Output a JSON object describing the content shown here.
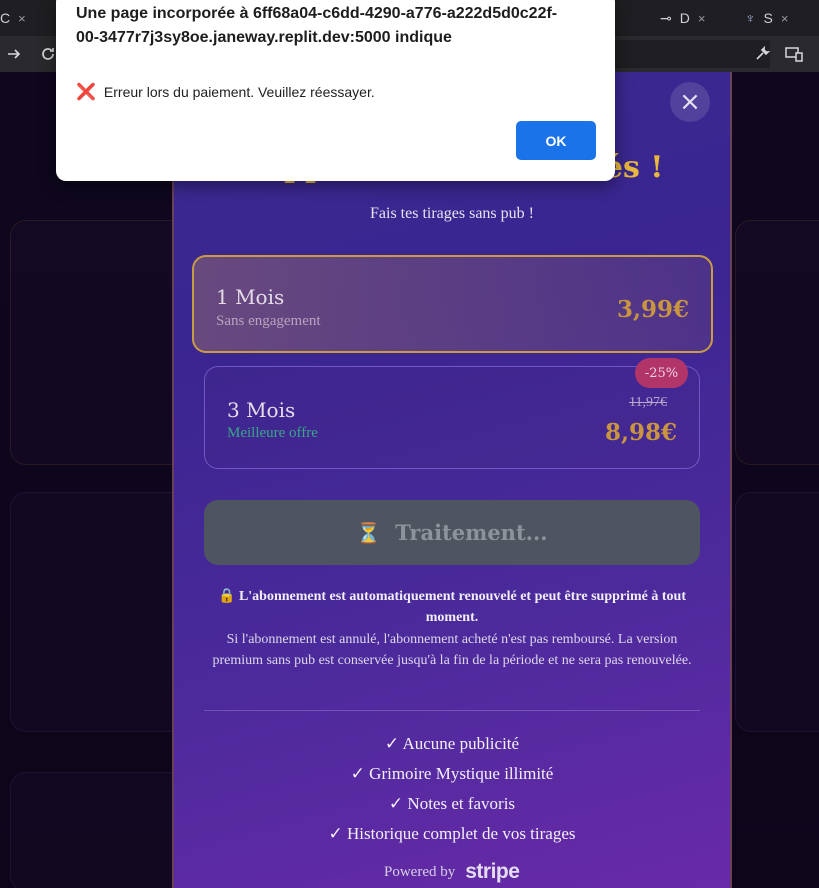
{
  "browser": {
    "tabs": [
      {
        "label": "C",
        "close": "×"
      },
      {
        "label": "D",
        "close": "×"
      },
      {
        "label": "S",
        "close": "×"
      }
    ],
    "toolbar": {
      "forward_icon": "arrow-right-icon",
      "reload_icon": "reload-icon",
      "extensions_icon": "wrench-icon",
      "devices_icon": "devices-icon"
    }
  },
  "modal": {
    "title": "Supprime les Publicités !",
    "subtitle": "Fais tes tirages sans pub !",
    "close_label": "×",
    "plans": [
      {
        "name": "1 Mois",
        "description": "Sans engagement",
        "price": "3,99€",
        "selected": true
      },
      {
        "name": "3 Mois",
        "description": "Meilleure offre",
        "old_price": "11,97€",
        "price": "8,98€",
        "badge": "-25%",
        "selected": false
      }
    ],
    "process_button": {
      "icon": "⏳",
      "label": "Traitement..."
    },
    "renewal_note": "L'abonnement est automatiquement renouvelé et peut être supprimé à tout moment.",
    "renewal_icon": "🔒",
    "cancel_note": "Si l'abonnement est annulé, l'abonnement acheté n'est pas remboursé. La version premium sans pub est conservée jusqu'à la fin de la période et ne sera pas renouvelée.",
    "features": [
      "✓ Aucune publicité",
      "✓ Grimoire Mystique illimité",
      "✓ Notes et favoris",
      "✓ Historique complet de vos tirages"
    ],
    "powered_by": "Powered by",
    "stripe": "stripe"
  },
  "alert": {
    "title": "Une page incorporée à 6ff68a04-c6dd-4290-a776-a222d5d0c22f-00-3477r7j3sy8oe.janeway.replit.dev:5000 indique",
    "icon": "❌",
    "message": "Erreur lors du paiement. Veuillez réessayer.",
    "ok_label": "OK"
  },
  "colors": {
    "accent_gold": "#e8b93d",
    "ok_blue": "#1a73e8",
    "badge_pink": "#b2356a",
    "offer_green": "#3aa68a"
  }
}
